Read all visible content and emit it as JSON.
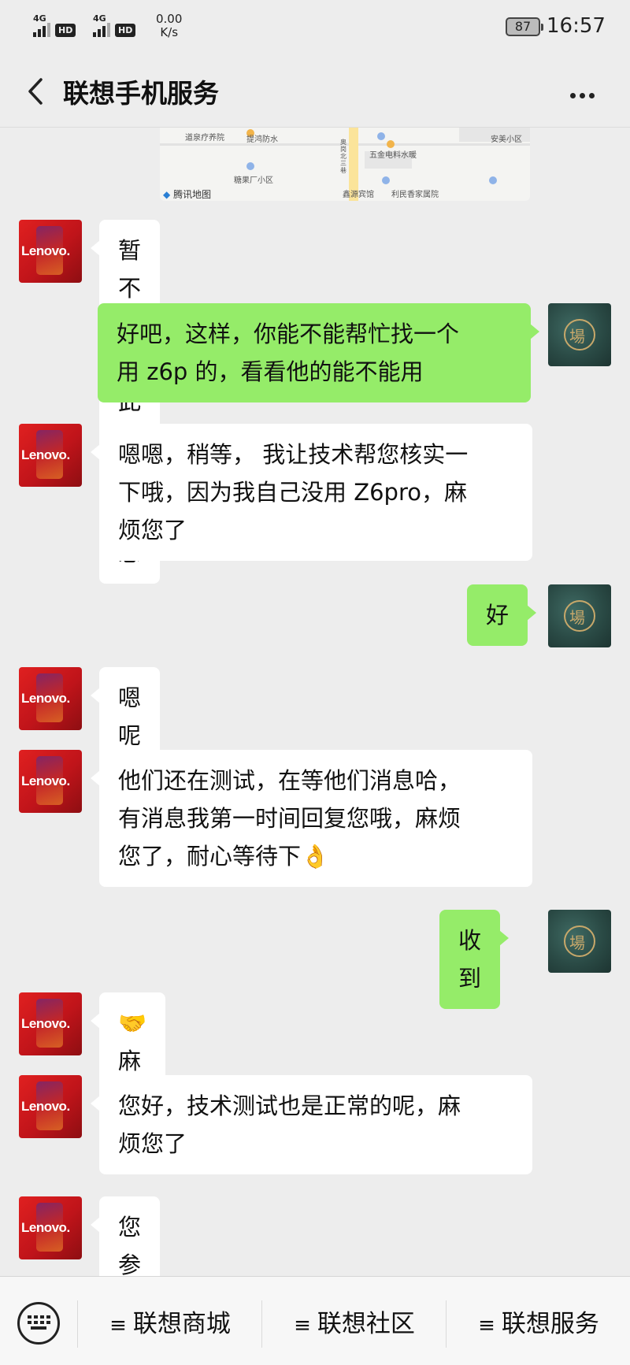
{
  "status_bar": {
    "signal1_label": "4G",
    "signal2_label": "4G",
    "hd1": "HD",
    "hd2": "HD",
    "net_speed_value": "0.00",
    "net_speed_unit": "K/s",
    "battery": "87",
    "time": "16:57"
  },
  "nav": {
    "title": "联想手机服务"
  },
  "map": {
    "labels": [
      "道泉疗养院",
      "提鸿防水",
      "奥岗北三巷",
      "五金电料水暖",
      "安美小区",
      "糖果厂小区",
      "鑫源宾馆",
      "利民香家属院"
    ],
    "logo": "腾讯地图"
  },
  "messages": [
    {
      "side": "left",
      "text": "暂不支持此类型消息"
    },
    {
      "side": "right",
      "text": "好吧，这样，你能不能帮忙找一个\n用 z6p 的，看看他的能不能用"
    },
    {
      "side": "left",
      "text": "嗯嗯，稍等， 我让技术帮您核实一\n下哦，因为我自己没用 Z6pro，麻\n烦您了"
    },
    {
      "side": "right",
      "text": "好"
    },
    {
      "side": "left",
      "text": "嗯呢"
    },
    {
      "side": "left",
      "text": "他们还在测试，在等他们消息哈，\n有消息我第一时间回复您哦，麻烦\n您了，耐心等待下👌"
    },
    {
      "side": "right",
      "text": "收到"
    },
    {
      "side": "left",
      "text": "🤝麻烦了"
    },
    {
      "side": "left",
      "text": "您好，技术测试也是正常的呢，麻\n烦您了"
    },
    {
      "side": "left",
      "text": "您参考下哦"
    }
  ],
  "avatars": {
    "service_brand": "Lenovo.",
    "me_glyph": "場"
  },
  "bottom_menu": {
    "items": [
      {
        "label": "联想商城"
      },
      {
        "label": "联想社区"
      },
      {
        "label": "联想服务"
      }
    ],
    "hamburger": "≡"
  },
  "colors": {
    "background": "#ededed",
    "bubble_left": "#ffffff",
    "bubble_right": "#95ec69",
    "lenovo_red": "#e02020"
  }
}
